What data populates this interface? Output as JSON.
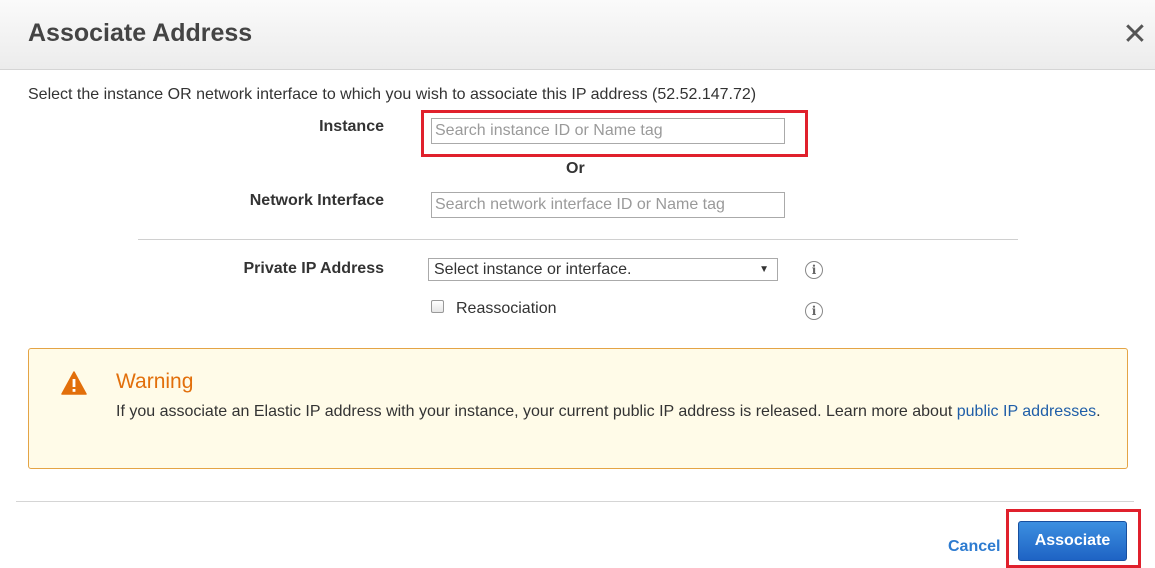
{
  "dialog": {
    "title": "Associate Address",
    "close_label": "✕",
    "description": "Select the instance OR network interface to which you wish to associate this IP address (52.52.147.72)"
  },
  "form": {
    "instance_label": "Instance",
    "instance_placeholder": "Search instance ID or Name tag",
    "or_text": "Or",
    "network_interface_label": "Network Interface",
    "network_interface_placeholder": "Search network interface ID or Name tag",
    "private_ip_label": "Private IP Address",
    "private_ip_select_value": "Select instance or interface.",
    "reassociation_label": "Reassociation",
    "reassociation_checked": false,
    "info_icon_glyph": "i"
  },
  "warning": {
    "title": "Warning",
    "body_text": "If you associate an Elastic IP address with your instance, your current public IP address is released. Learn more about ",
    "link_text": "public IP addresses",
    "body_suffix": ".",
    "icon": "warning-triangle-icon",
    "accent_color": "#e26f0b"
  },
  "footer": {
    "cancel_label": "Cancel",
    "associate_label": "Associate"
  },
  "colors": {
    "highlight": "#e0202c",
    "primary_button": "#1e63c4",
    "link": "#1f5ea8"
  }
}
